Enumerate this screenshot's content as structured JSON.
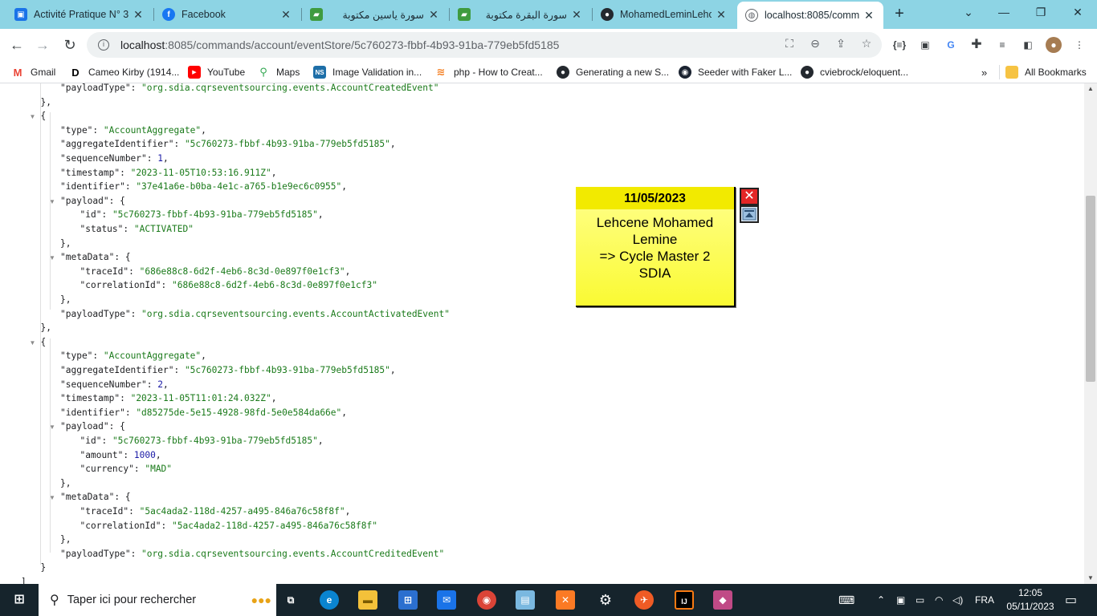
{
  "tabs": [
    {
      "title": "Activité Pratique N° 3",
      "icon": "bookmark-icon",
      "color": "#1a73e8"
    },
    {
      "title": "Facebook",
      "icon": "facebook-icon",
      "color": "#1877f2"
    },
    {
      "title": "سورة ياسين مكتوبة",
      "icon": "book-icon",
      "color": "#3f9b3f"
    },
    {
      "title": "سورة البقرة مكتوبة",
      "icon": "book-icon",
      "color": "#3f9b3f"
    },
    {
      "title": "MohamedLeminLehc",
      "icon": "github-icon",
      "color": "#24292f"
    },
    {
      "title": "localhost:8085/comm",
      "icon": "globe-icon",
      "color": "#5f6368"
    }
  ],
  "address": {
    "host": "localhost",
    "path": ":8085/commands/account/eventStore/5c760273-fbbf-4b93-91ba-779eb5fd5185"
  },
  "bookmarks": [
    {
      "label": "Gmail",
      "icon": "gmail-icon",
      "color": "#ea4335"
    },
    {
      "label": "Cameo Kirby (1914...",
      "icon": "d-icon",
      "color": "#000000"
    },
    {
      "label": "YouTube",
      "icon": "youtube-icon",
      "color": "#ff0000"
    },
    {
      "label": "Maps",
      "icon": "maps-icon",
      "color": "#34a853"
    },
    {
      "label": "Image Validation in...",
      "icon": "ns-icon",
      "color": "#1e6fa8"
    },
    {
      "label": "php - How to Creat...",
      "icon": "stackoverflow-icon",
      "color": "#f48024"
    },
    {
      "label": "Generating a new S...",
      "icon": "github-icon",
      "color": "#24292f"
    },
    {
      "label": "Seeder with Faker L...",
      "icon": "laracasts-icon",
      "color": "#1b2330"
    },
    {
      "label": "cviebrock/eloquent...",
      "icon": "github-icon",
      "color": "#24292f"
    }
  ],
  "all_bookmarks": "All Bookmarks",
  "json_lines": [
    {
      "indent": 2,
      "html": "<span class='k'>\"payloadType\"</span>: <span class='s'>\"org.sdia.cqrseventsourcing.events.AccountCreatedEvent\"</span>"
    },
    {
      "indent": 1,
      "html": "},"
    },
    {
      "indent": 1,
      "tri": true,
      "html": "{"
    },
    {
      "indent": 2,
      "html": "<span class='k'>\"type\"</span>: <span class='s'>\"AccountAggregate\"</span>,"
    },
    {
      "indent": 2,
      "html": "<span class='k'>\"aggregateIdentifier\"</span>: <span class='s'>\"5c760273-fbbf-4b93-91ba-779eb5fd5185\"</span>,"
    },
    {
      "indent": 2,
      "html": "<span class='k'>\"sequenceNumber\"</span>: <span class='n'>1</span>,"
    },
    {
      "indent": 2,
      "html": "<span class='k'>\"timestamp\"</span>: <span class='s'>\"2023-11-05T10:53:16.911Z\"</span>,"
    },
    {
      "indent": 2,
      "html": "<span class='k'>\"identifier\"</span>: <span class='s'>\"37e41a6e-b0ba-4e1c-a765-b1e9ec6c0955\"</span>,"
    },
    {
      "indent": 2,
      "tri": true,
      "html": "<span class='k'>\"payload\"</span>: {"
    },
    {
      "indent": 3,
      "html": "<span class='k'>\"id\"</span>: <span class='s'>\"5c760273-fbbf-4b93-91ba-779eb5fd5185\"</span>,"
    },
    {
      "indent": 3,
      "html": "<span class='k'>\"status\"</span>: <span class='s'>\"ACTIVATED\"</span>"
    },
    {
      "indent": 2,
      "html": "},"
    },
    {
      "indent": 2,
      "tri": true,
      "html": "<span class='k'>\"metaData\"</span>: {"
    },
    {
      "indent": 3,
      "html": "<span class='k'>\"traceId\"</span>: <span class='s'>\"686e88c8-6d2f-4eb6-8c3d-0e897f0e1cf3\"</span>,"
    },
    {
      "indent": 3,
      "html": "<span class='k'>\"correlationId\"</span>: <span class='s'>\"686e88c8-6d2f-4eb6-8c3d-0e897f0e1cf3\"</span>"
    },
    {
      "indent": 2,
      "html": "},"
    },
    {
      "indent": 2,
      "html": "<span class='k'>\"payloadType\"</span>: <span class='s'>\"org.sdia.cqrseventsourcing.events.AccountActivatedEvent\"</span>"
    },
    {
      "indent": 1,
      "html": "},"
    },
    {
      "indent": 1,
      "tri": true,
      "html": "{"
    },
    {
      "indent": 2,
      "html": "<span class='k'>\"type\"</span>: <span class='s'>\"AccountAggregate\"</span>,"
    },
    {
      "indent": 2,
      "html": "<span class='k'>\"aggregateIdentifier\"</span>: <span class='s'>\"5c760273-fbbf-4b93-91ba-779eb5fd5185\"</span>,"
    },
    {
      "indent": 2,
      "html": "<span class='k'>\"sequenceNumber\"</span>: <span class='n'>2</span>,"
    },
    {
      "indent": 2,
      "html": "<span class='k'>\"timestamp\"</span>: <span class='s'>\"2023-11-05T11:01:24.032Z\"</span>,"
    },
    {
      "indent": 2,
      "html": "<span class='k'>\"identifier\"</span>: <span class='s'>\"d85275de-5e15-4928-98fd-5e0e584da66e\"</span>,"
    },
    {
      "indent": 2,
      "tri": true,
      "html": "<span class='k'>\"payload\"</span>: {"
    },
    {
      "indent": 3,
      "html": "<span class='k'>\"id\"</span>: <span class='s'>\"5c760273-fbbf-4b93-91ba-779eb5fd5185\"</span>,"
    },
    {
      "indent": 3,
      "html": "<span class='k'>\"amount\"</span>: <span class='n'>1000</span>,"
    },
    {
      "indent": 3,
      "html": "<span class='k'>\"currency\"</span>: <span class='s'>\"MAD\"</span>"
    },
    {
      "indent": 2,
      "html": "},"
    },
    {
      "indent": 2,
      "tri": true,
      "html": "<span class='k'>\"metaData\"</span>: {"
    },
    {
      "indent": 3,
      "html": "<span class='k'>\"traceId\"</span>: <span class='s'>\"5ac4ada2-118d-4257-a495-846a76c58f8f\"</span>,"
    },
    {
      "indent": 3,
      "html": "<span class='k'>\"correlationId\"</span>: <span class='s'>\"5ac4ada2-118d-4257-a495-846a76c58f8f\"</span>"
    },
    {
      "indent": 2,
      "html": "},"
    },
    {
      "indent": 2,
      "html": "<span class='k'>\"payloadType\"</span>: <span class='s'>\"org.sdia.cqrseventsourcing.events.AccountCreditedEvent\"</span>"
    },
    {
      "indent": 1,
      "html": "}"
    },
    {
      "indent": 0,
      "html": "]"
    }
  ],
  "sticky_note": {
    "date": "11/05/2023",
    "text": "Lehcene Mohamed\nLemine\n=> Cycle Master 2\nSDIA"
  },
  "taskbar": {
    "search_placeholder": "Taper ici pour rechercher",
    "language": "FRA",
    "time": "12:05",
    "date": "05/11/2023"
  }
}
